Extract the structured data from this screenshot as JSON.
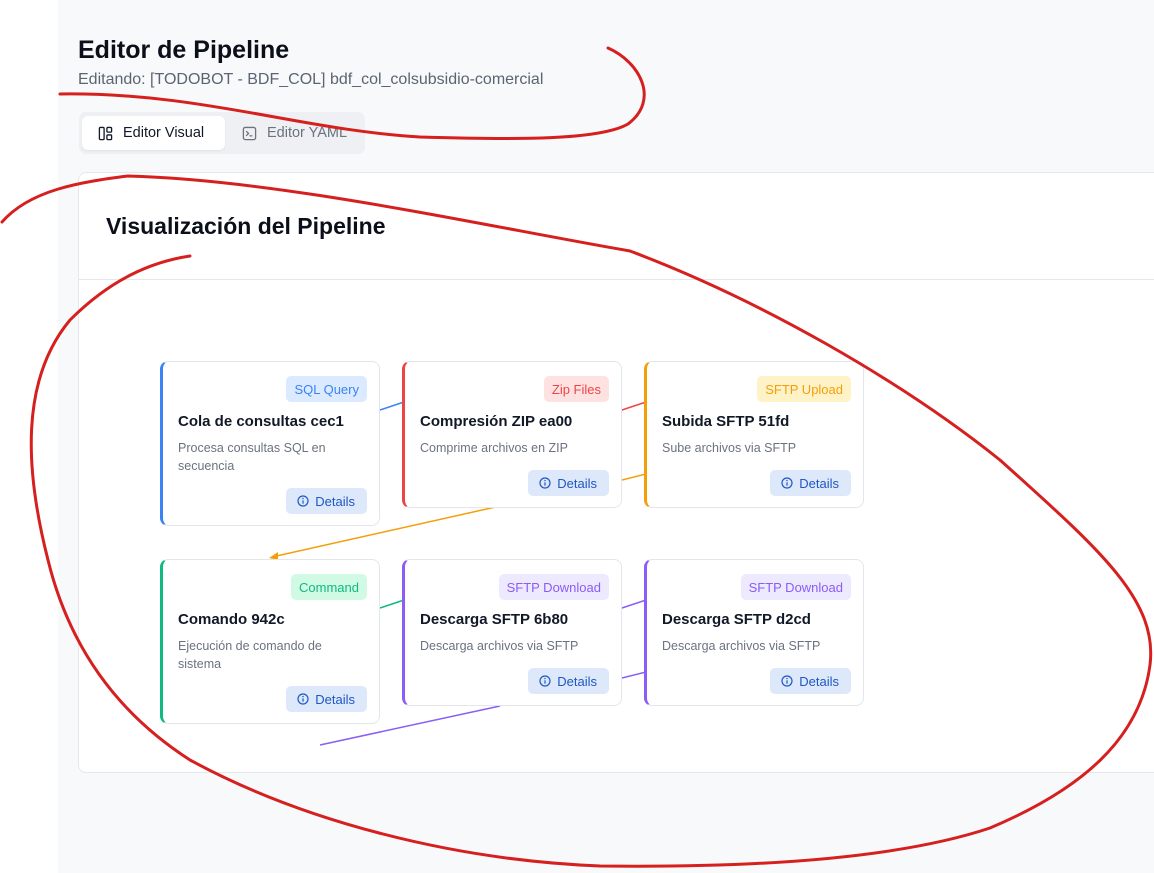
{
  "header": {
    "title": "Editor de Pipeline",
    "subtitle": "Editando: [TODOBOT - BDF_COL] bdf_col_colsubsidio-comercial"
  },
  "tabs": [
    {
      "label": "Editor Visual",
      "icon": "layout-icon",
      "active": true
    },
    {
      "label": "Editor YAML",
      "icon": "terminal-icon",
      "active": false
    }
  ],
  "visualization": {
    "title": "Visualización del Pipeline",
    "details_label": "Details",
    "nodes": [
      {
        "id": "cec1",
        "badge": "SQL Query",
        "title": "Cola de consultas cec1",
        "description": "Procesa consultas SQL en secuencia",
        "color": "#3b82f6",
        "badge_bg": "#dbeafe"
      },
      {
        "id": "ea00",
        "badge": "Zip Files",
        "title": "Compresión ZIP ea00",
        "description": "Comprime archivos en ZIP",
        "color": "#ef4444",
        "badge_bg": "#fee2e2"
      },
      {
        "id": "51fd",
        "badge": "SFTP Upload",
        "title": "Subida SFTP 51fd",
        "description": "Sube archivos via SFTP",
        "color": "#f59e0b",
        "badge_bg": "#fef3c7"
      },
      {
        "id": "942c",
        "badge": "Command",
        "title": "Comando 942c",
        "description": "Ejecución de comando de sistema",
        "color": "#10b981",
        "badge_bg": "#d1fae5"
      },
      {
        "id": "6b80",
        "badge": "SFTP Download",
        "title": "Descarga SFTP 6b80",
        "description": "Descarga archivos via SFTP",
        "color": "#8b5cf6",
        "badge_bg": "#ede9fe"
      },
      {
        "id": "d2cd",
        "badge": "SFTP Download",
        "title": "Descarga SFTP d2cd",
        "description": "Descarga archivos via SFTP",
        "color": "#8b5cf6",
        "badge_bg": "#ede9fe"
      }
    ]
  },
  "colors": {
    "annotation": "#d61f1f",
    "details_bg": "#dde9fb",
    "details_text": "#1f57c3"
  }
}
